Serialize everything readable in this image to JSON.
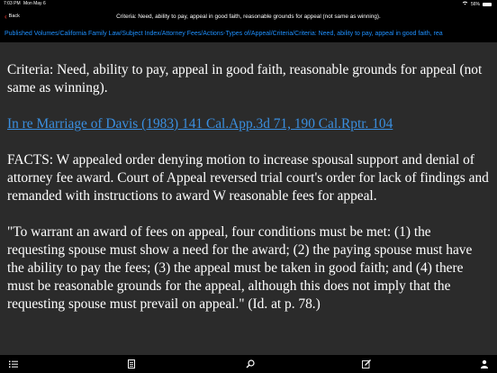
{
  "status": {
    "time": "7:03 PM",
    "date": "Mon May 6",
    "battery": "56%"
  },
  "nav": {
    "back_label": "Back",
    "title": "Criteria: Need, ability to pay, appeal in good faith, reasonable grounds for appeal (not same as winning)."
  },
  "breadcrumb": "Published Volumes/California Family Law/Subject Index/Attorney Fees/Actions-Types of/Appeal/Criteria/Criteria: Need, ability to pay, appeal in good faith, rea",
  "content": {
    "heading": "Criteria: Need, ability to pay, appeal in good faith, reasonable grounds for appeal (not same as winning).",
    "case_link": "In re Marriage of Davis (1983) 141 Cal.App.3d 71, 190 Cal.Rptr. 104",
    "facts": "FACTS: W appealed order denying motion to increase spousal support and denial of attorney fee award. Court of Appeal reversed trial court's order for lack of findings and remanded with instructions to award W reasonable fees for appeal.",
    "quote": "\"To warrant an award of fees on appeal, four conditions must be met: (1) the requesting spouse must show a need for the award; (2) the paying spouse must have the ability to pay the fees; (3) the appeal must be taken in good faith; and (4) there must be reasonable grounds for the appeal, although this does not imply that the requesting spouse must prevail on appeal.\" (Id. at p. 78.)"
  },
  "toolbar": {
    "items": [
      "list-icon",
      "document-icon",
      "search-icon",
      "edit-icon",
      "person-icon"
    ]
  }
}
